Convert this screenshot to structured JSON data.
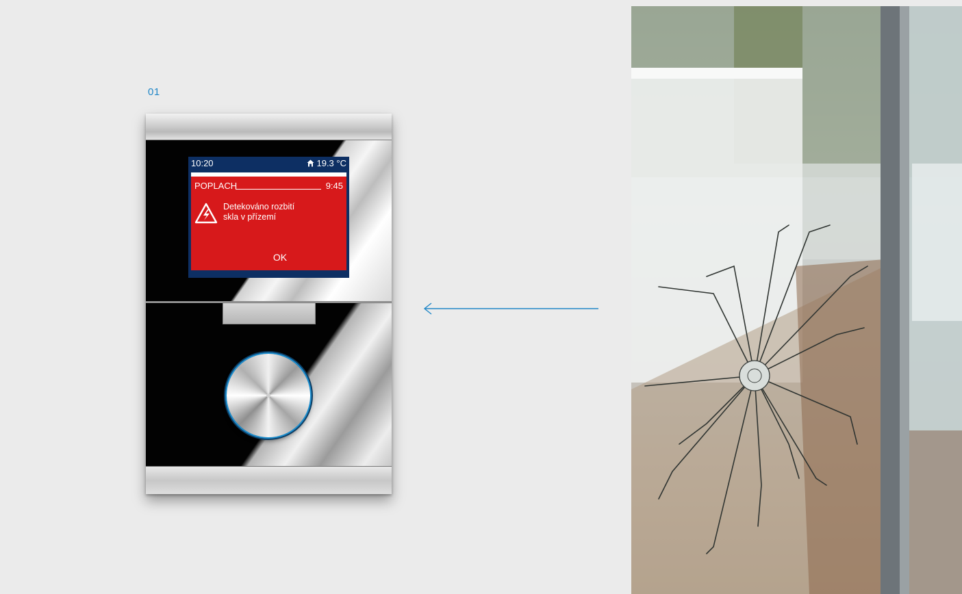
{
  "figure_label": "01",
  "device": {
    "status_bar": {
      "time": "10:20",
      "temperature": "19.3 °C"
    },
    "alarm": {
      "title": "POPLACH",
      "time": "9:45",
      "message_line1": "Detekováno rozbití",
      "message_line2": "skla v přízemí",
      "ok_label": "OK"
    }
  },
  "colors": {
    "accent": "#1f86c7",
    "screen_background": "#0d2f63",
    "alarm_red": "#d7191b"
  },
  "icons": {
    "house": "house-icon",
    "warning": "broken-glass-warning-icon",
    "arrow": "arrow-left-icon"
  }
}
